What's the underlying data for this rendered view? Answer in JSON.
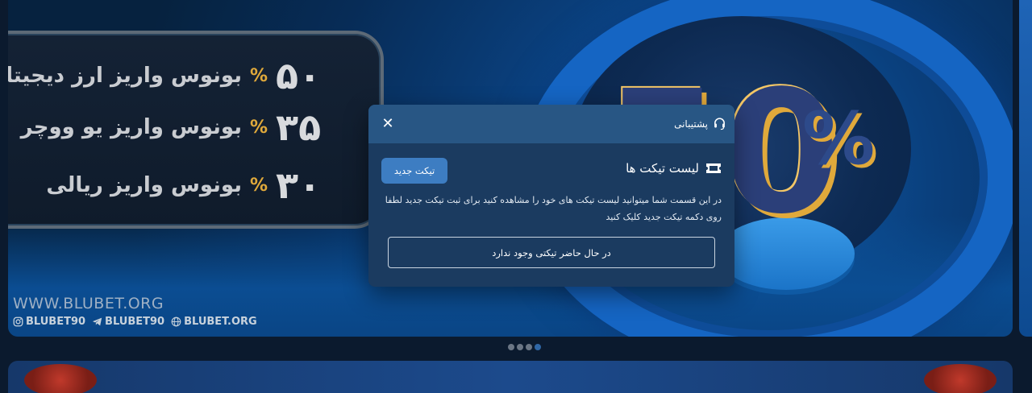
{
  "banner": {
    "bonus_rows": [
      {
        "label": "بونوس واریز ارز دیجیتال",
        "number": "۵۰",
        "percent": "%"
      },
      {
        "label": "بونوس واریز یو ووچر",
        "number": "۳۵",
        "percent": "%"
      },
      {
        "label": "بونوس واریز ریالی",
        "number": "۳۰",
        "percent": "%"
      }
    ],
    "hero_number": "50",
    "hero_percent": "%",
    "watermark": "WWW.BLUBET.ORG",
    "socials": [
      {
        "icon": "instagram-icon",
        "handle": "BLUBET90"
      },
      {
        "icon": "telegram-icon",
        "handle": "BLUBET90"
      },
      {
        "icon": "globe-icon",
        "handle": "BLUBET.ORG"
      }
    ]
  },
  "carousel": {
    "dot_count": 4,
    "active_index": 3
  },
  "modal": {
    "close_label": "✕",
    "header_title": "پشتیبانی",
    "section_title": "لیست تیکت ها",
    "new_ticket_label": "تیکت جدید",
    "description": "در این قسمت شما میتوانید لیست تیکت های خود را مشاهده کنید برای ثبت تیکت جدید لطفا روی دکمه تیکت جدید کلیک کنید",
    "empty_message": "در حال حاضر تیکتی وجود ندارد"
  },
  "colors": {
    "modal_bg": "#1b3b60",
    "modal_header": "#285684",
    "button": "#3d7dc2",
    "accent_gold": "#e0a93b"
  }
}
